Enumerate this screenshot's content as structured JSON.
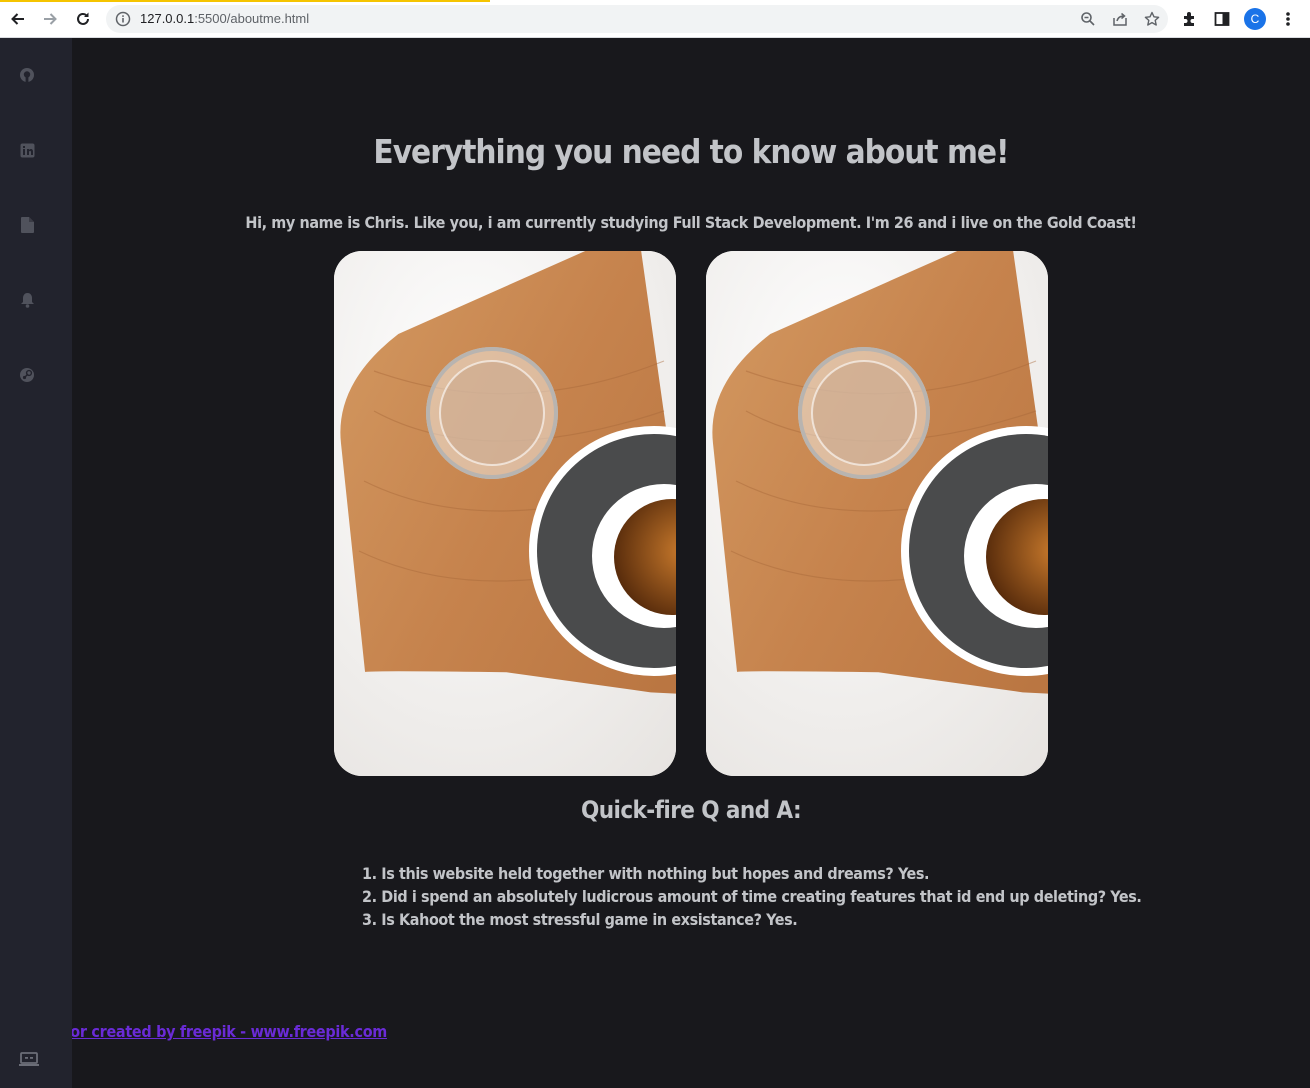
{
  "browser": {
    "url_host": "127.0.0.1",
    "url_rest": ":5500/aboutme.html",
    "avatar_letter": "C",
    "toolbar_icons": [
      "back-icon",
      "forward-icon",
      "reload-icon",
      "info-icon",
      "zoom-icon",
      "share-icon",
      "star-icon",
      "extensions-icon",
      "side-panel-icon",
      "kebab-menu-icon"
    ]
  },
  "sidebar": {
    "items": [
      {
        "icon": "github-icon"
      },
      {
        "icon": "linkedin-icon"
      },
      {
        "icon": "document-icon"
      },
      {
        "icon": "bell-icon"
      },
      {
        "icon": "steam-icon"
      }
    ],
    "bottom_icon": "laptop-icon"
  },
  "main": {
    "title": "Everything you need to know about me!",
    "intro": "Hi, my name is Chris. Like you, i am currently studying Full Stack Development. I'm 26 and i live on the Gold Coast!",
    "qa_title": "Quick-fire Q and A:",
    "qa_items": [
      "1. Is this website held together with nothing but hopes and dreams? Yes.",
      "2. Did i spend an absolutely ludicrous amount of time creating features that id end up deleting? Yes.",
      "3. Is Kahoot the most stressful game in exsistance? Yes."
    ],
    "credit_link": "Abstract vector created by freepik - www.freepik.com"
  },
  "colors": {
    "page_bg": "#18181c",
    "sidebar_bg": "#22232d",
    "text": "#c2c4c8",
    "link": "#6a2bd6"
  }
}
